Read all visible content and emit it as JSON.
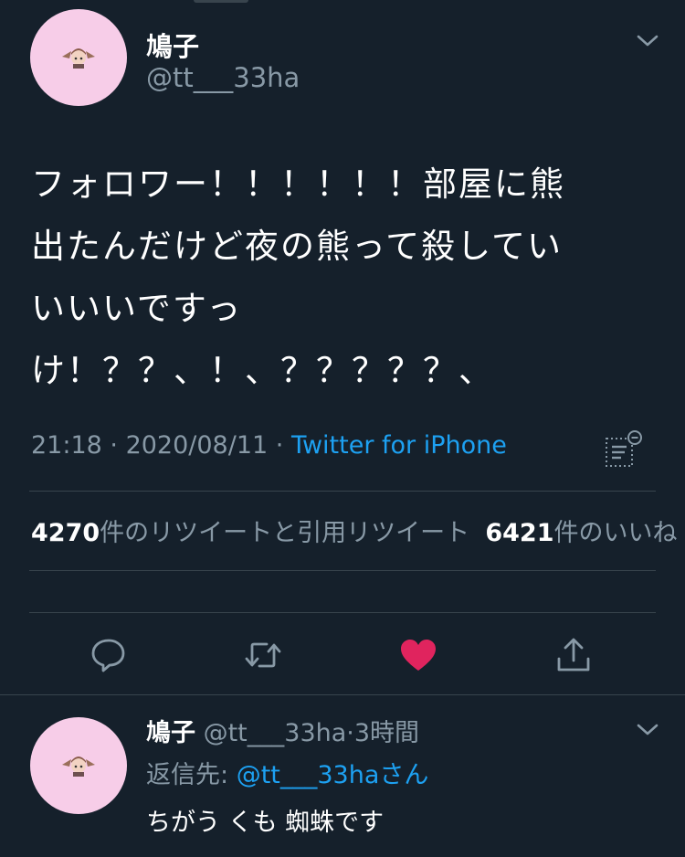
{
  "tweet": {
    "display_name": "鳩子",
    "handle": "@tt___33ha",
    "text": "フォロワー！！！！！！部屋に熊\n出たんだけど夜の熊って殺してい\nいいいですっ\nけ！？？、！、？？？？？、",
    "time": "21:18",
    "sep": " · ",
    "date": "2020/08/11",
    "sep2": " · ",
    "source": "Twitter for iPhone",
    "retweets_count": "4270",
    "retweets_label": "件のリツイートと引用リツイート",
    "likes_count": "6421",
    "likes_label": "件のいいね",
    "liked": true,
    "heart_color": "#e0245e",
    "icons": {
      "menu": "chevron-down-icon",
      "analytics": "analytics-icon",
      "reply": "reply-icon",
      "retweet": "retweet-icon",
      "like": "heart-icon",
      "share": "share-icon"
    }
  },
  "reply": {
    "display_name": "鳩子",
    "handle": "@tt___33ha",
    "dot": "·",
    "time_ago": "3時間",
    "reply_prefix": "返信先: ",
    "reply_to_handle": "@tt___33ha",
    "reply_to_suffix": "さん",
    "text": "ちがう くも 蜘蛛です"
  },
  "colors": {
    "background": "#15202b",
    "muted": "#8899a6",
    "link": "#1da1f2",
    "avatar_bg": "#f7cde8"
  }
}
